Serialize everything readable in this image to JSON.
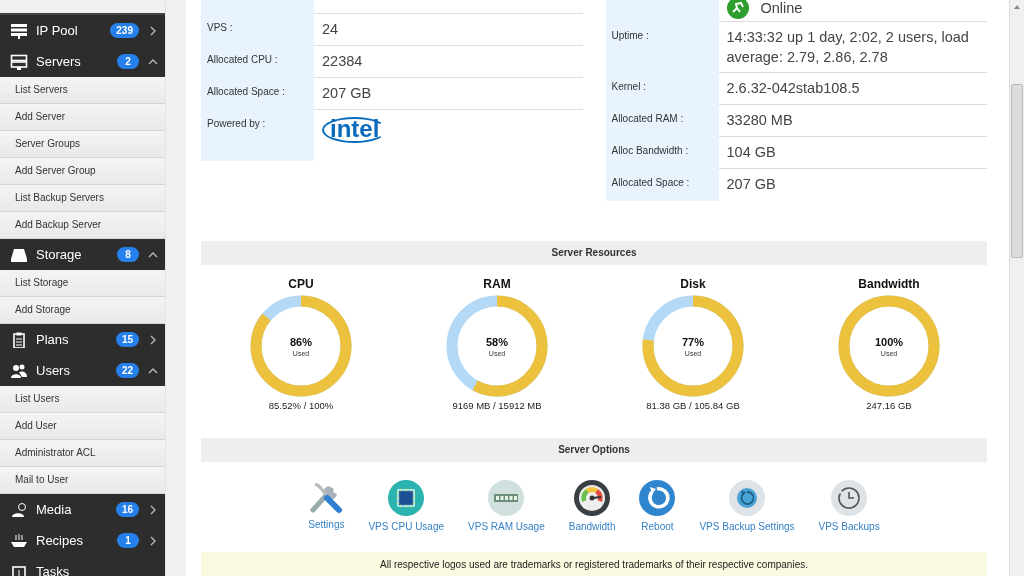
{
  "sidebar": {
    "items": [
      {
        "label": "IP Pool",
        "count": "239",
        "expanded": false
      },
      {
        "label": "Servers",
        "count": "2",
        "expanded": true,
        "children": [
          {
            "label": "List Servers"
          },
          {
            "label": "Add Server"
          },
          {
            "label": "Server Groups"
          },
          {
            "label": "Add Server Group"
          },
          {
            "label": "List Backup Servers"
          },
          {
            "label": "Add Backup Server"
          }
        ]
      },
      {
        "label": "Storage",
        "count": "8",
        "expanded": true,
        "children": [
          {
            "label": "List Storage"
          },
          {
            "label": "Add Storage"
          }
        ]
      },
      {
        "label": "Plans",
        "count": "15",
        "expanded": false
      },
      {
        "label": "Users",
        "count": "22",
        "expanded": true,
        "children": [
          {
            "label": "List Users"
          },
          {
            "label": "Add User"
          },
          {
            "label": "Administrator ACL"
          },
          {
            "label": "Mail to User"
          }
        ]
      },
      {
        "label": "Media",
        "count": "16",
        "expanded": false
      },
      {
        "label": "Recipes",
        "count": "1",
        "expanded": false
      },
      {
        "label": "Tasks"
      }
    ]
  },
  "server_info": {
    "left": [
      {
        "kind": "text",
        "label": "VPS :",
        "value": "24"
      },
      {
        "kind": "text",
        "label": "Allocated CPU :",
        "value": "22384"
      },
      {
        "kind": "text",
        "label": "Allocated Space :",
        "value": "207 GB"
      },
      {
        "kind": "logo",
        "label": "Powered by :",
        "value": "intel"
      }
    ],
    "right": [
      {
        "kind": "status",
        "value": "Online"
      },
      {
        "kind": "text",
        "label": "Uptime :",
        "value": "14:33:32 up 1 day, 2:02, 2 users, load average: 2.79, 2.86, 2.78"
      },
      {
        "kind": "text",
        "label": "Kernel :",
        "value": "2.6.32-042stab108.5"
      },
      {
        "kind": "text",
        "label": "Allocated RAM :",
        "value": "33280 MB"
      },
      {
        "kind": "text",
        "label": "Alloc Bandwidth :",
        "value": "104 GB"
      },
      {
        "kind": "text",
        "label": "Allocated Space :",
        "value": "207 GB"
      }
    ]
  },
  "resources": {
    "title": "Server Resources",
    "items": [
      {
        "name": "CPU",
        "level": 0.86,
        "percent": "86%",
        "caption": "Used",
        "detail": "85.52% / 100%"
      },
      {
        "name": "RAM",
        "level": 0.58,
        "percent": "58%",
        "caption": "Used",
        "detail": "9169 MB / 15912 MB"
      },
      {
        "name": "Disk",
        "level": 0.77,
        "percent": "77%",
        "caption": "Used",
        "detail": "81.38 GB / 105.84 GB"
      },
      {
        "name": "Bandwidth",
        "level": 1.0,
        "percent": "100%",
        "caption": "Used",
        "detail": "247.16 GB"
      }
    ]
  },
  "options": {
    "title": "Server Options",
    "items": [
      {
        "label": "Settings"
      },
      {
        "label": "VPS CPU Usage"
      },
      {
        "label": "VPS RAM Usage"
      },
      {
        "label": "Bandwidth"
      },
      {
        "label": "Reboot"
      },
      {
        "label": "VPS Backup Settings"
      },
      {
        "label": "VPS Backups"
      }
    ]
  },
  "notice": "All respective logos used are trademarks or registered trademarks of their respective companies."
}
